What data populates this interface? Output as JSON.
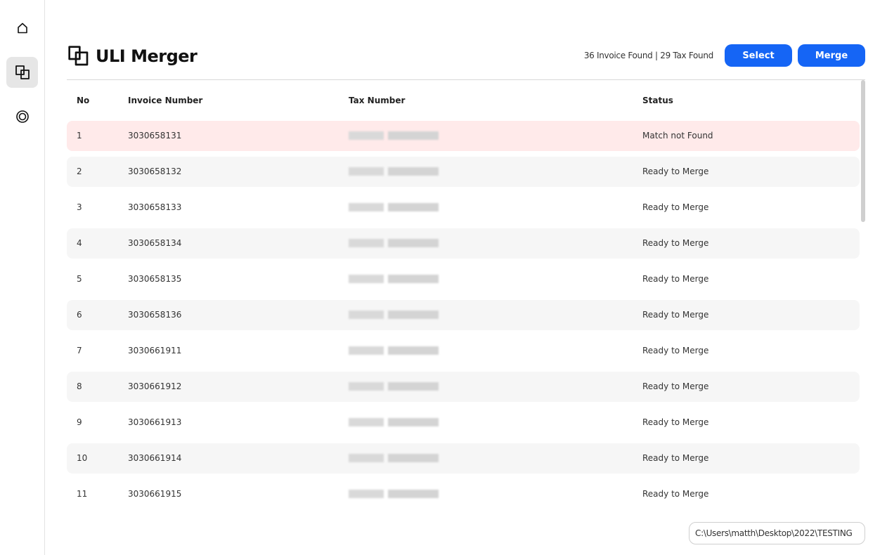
{
  "sidebar": {
    "items": [
      {
        "icon": "home-icon"
      },
      {
        "icon": "merge-icon",
        "active": true
      },
      {
        "icon": "target-icon"
      }
    ]
  },
  "header": {
    "title": "ULI Merger",
    "found_text": "36 Invoice Found | 29 Tax Found",
    "select_label": "Select",
    "merge_label": "Merge"
  },
  "table": {
    "columns": {
      "no": "No",
      "invoice": "Invoice Number",
      "tax": "Tax Number",
      "status": "Status"
    },
    "rows": [
      {
        "no": "1",
        "invoice": "3030658131",
        "status": "Match not Found",
        "style": "warn"
      },
      {
        "no": "2",
        "invoice": "3030658132",
        "status": "Ready to Merge",
        "style": "alt"
      },
      {
        "no": "3",
        "invoice": "3030658133",
        "status": "Ready to Merge",
        "style": ""
      },
      {
        "no": "4",
        "invoice": "3030658134",
        "status": "Ready to Merge",
        "style": "alt"
      },
      {
        "no": "5",
        "invoice": "3030658135",
        "status": "Ready to Merge",
        "style": ""
      },
      {
        "no": "6",
        "invoice": "3030658136",
        "status": "Ready to Merge",
        "style": "alt"
      },
      {
        "no": "7",
        "invoice": "3030661911",
        "status": "Ready to Merge",
        "style": ""
      },
      {
        "no": "8",
        "invoice": "3030661912",
        "status": "Ready to Merge",
        "style": "alt"
      },
      {
        "no": "9",
        "invoice": "3030661913",
        "status": "Ready to Merge",
        "style": ""
      },
      {
        "no": "10",
        "invoice": "3030661914",
        "status": "Ready to Merge",
        "style": "alt"
      },
      {
        "no": "11",
        "invoice": "3030661915",
        "status": "Ready to Merge",
        "style": ""
      }
    ]
  },
  "footer": {
    "path": "C:\\Users\\matth\\Desktop\\2022\\TESTING"
  },
  "colors": {
    "accent": "#1565f5",
    "warn_row": "#ffeaea",
    "alt_row": "#f6f6f6"
  }
}
